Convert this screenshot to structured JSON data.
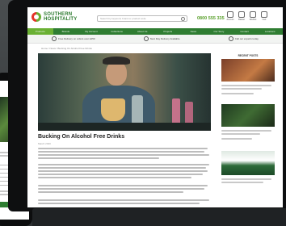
{
  "site": {
    "brand_line1": "SOUTHERN",
    "brand_line2": "HOSPITALITY",
    "search_placeholder": "Search by keyword, brand or product code",
    "phone": "0800 555 335",
    "header_icons": [
      {
        "name": "user-icon",
        "label": "Account"
      },
      {
        "name": "basket-icon",
        "label": "Basket"
      },
      {
        "name": "wishlist-icon",
        "label": "Wishlist"
      },
      {
        "name": "cart-icon",
        "label": "Cart"
      }
    ],
    "nav": [
      "Products",
      "Brands",
      "My Account",
      "Collections",
      "About Us",
      "Projects",
      "News",
      "Our Story",
      "Contact",
      "Locations"
    ],
    "usps": [
      "Free Delivery on orders over £250",
      "Next Day Delivery Available",
      "Call our experts today"
    ]
  },
  "article": {
    "breadcrumb": "Home / News / Bucking On Alcohol Free Drinks",
    "title": "Bucking On Alcohol Free Drinks",
    "date": "March 2020"
  },
  "sidebar": {
    "heading": "RECENT POSTS"
  },
  "colors": {
    "brand_green": "#2f7d32",
    "accent_green": "#6ab033",
    "brand_red": "#e5332a"
  }
}
